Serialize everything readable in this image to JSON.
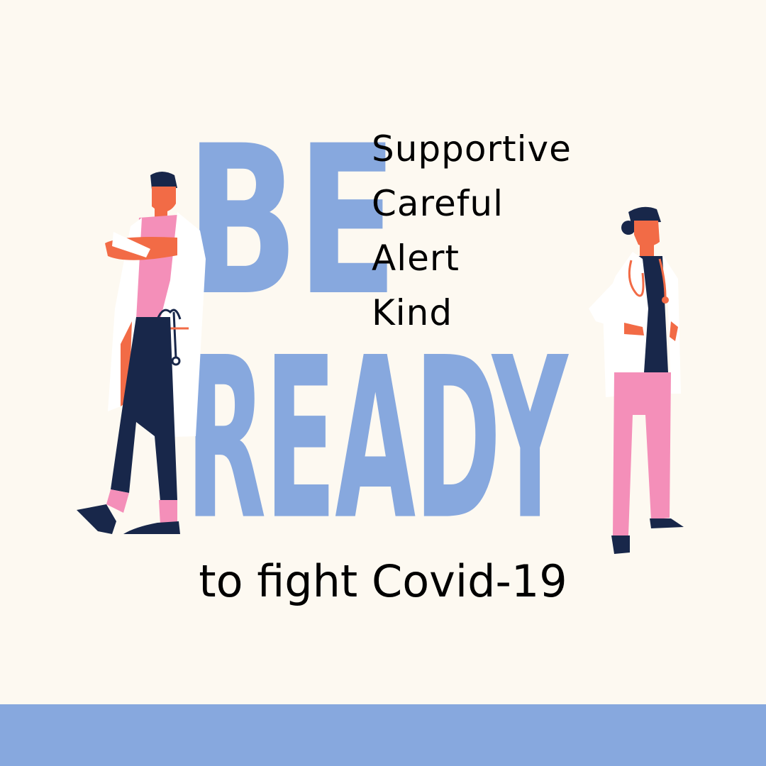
{
  "headline": {
    "line1": "BE",
    "line2": "READY"
  },
  "qualities": [
    "Supportive",
    "Careful",
    "Alert",
    "Kind"
  ],
  "tagline": "to fight Covid-19",
  "colors": {
    "background": "#fdf9f1",
    "accent_blue": "#87a8de",
    "text": "#000000",
    "navy": "#18274a",
    "pink": "#f48fb9",
    "orange_skin": "#f26b46",
    "coat_white": "#ffffff"
  }
}
